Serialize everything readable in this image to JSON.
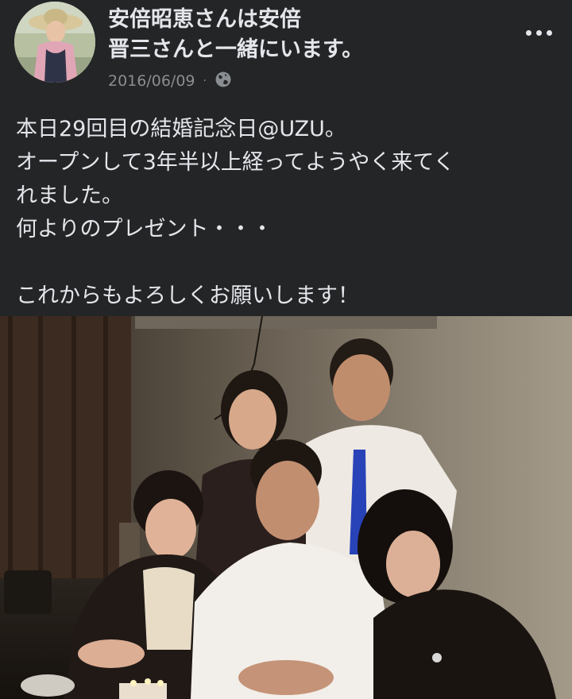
{
  "post": {
    "author_line_1": "安倍昭恵さんは安倍",
    "author_line_2": "晋三さんと一緒にいます。",
    "date": "2016/06/09",
    "separator": "·",
    "privacy_icon": "globe-icon",
    "more_icon": "more-dots-icon",
    "text_lines": [
      "本日29回目の結婚記念日@UZU。",
      "オープンして3年半以上経ってようやく来てく",
      "れました。",
      "何よりのプレゼント・・・",
      "",
      "これからもよろしくお願いします！"
    ]
  },
  "colors": {
    "background": "#242526",
    "text_primary": "#e4e6eb",
    "text_secondary": "#8a8d91"
  }
}
